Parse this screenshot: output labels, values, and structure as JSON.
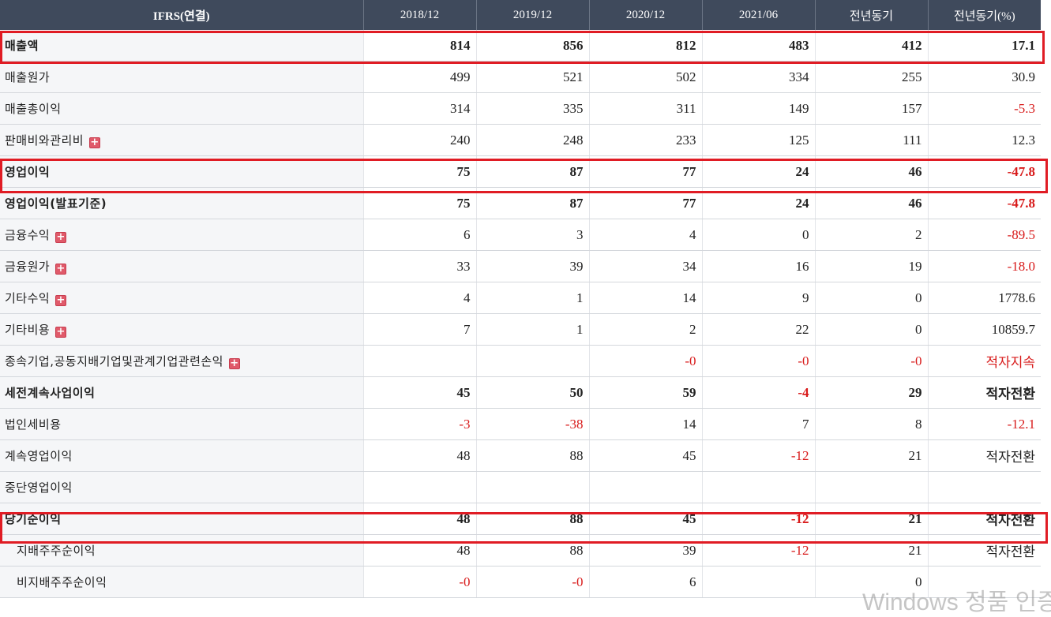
{
  "header": {
    "label": "IFRS(연결)",
    "columns": [
      "2018/12",
      "2019/12",
      "2020/12",
      "2021/06",
      "전년동기",
      "전년동기(%)"
    ]
  },
  "rows": [
    {
      "label": "매출액",
      "values": [
        "814",
        "856",
        "812",
        "483",
        "412",
        "17.1"
      ]
    },
    {
      "label": "매출원가",
      "values": [
        "499",
        "521",
        "502",
        "334",
        "255",
        "30.9"
      ]
    },
    {
      "label": "매출총이익",
      "values": [
        "314",
        "335",
        "311",
        "149",
        "157",
        "-5.3"
      ]
    },
    {
      "label": "판매비와관리비",
      "values": [
        "240",
        "248",
        "233",
        "125",
        "111",
        "12.3"
      ]
    },
    {
      "label": "영업이익",
      "values": [
        "75",
        "87",
        "77",
        "24",
        "46",
        "-47.8"
      ]
    },
    {
      "label": "영업이익(발표기준)",
      "values": [
        "75",
        "87",
        "77",
        "24",
        "46",
        "-47.8"
      ]
    },
    {
      "label": "금융수익",
      "values": [
        "6",
        "3",
        "4",
        "0",
        "2",
        "-89.5"
      ]
    },
    {
      "label": "금융원가",
      "values": [
        "33",
        "39",
        "34",
        "16",
        "19",
        "-18.0"
      ]
    },
    {
      "label": "기타수익",
      "values": [
        "4",
        "1",
        "14",
        "9",
        "0",
        "1778.6"
      ]
    },
    {
      "label": "기타비용",
      "values": [
        "7",
        "1",
        "2",
        "22",
        "0",
        "10859.7"
      ]
    },
    {
      "label": "종속기업,공동지배기업및관계기업관련손익",
      "values": [
        "",
        "",
        "-0",
        "-0",
        "-0",
        "적자지속"
      ]
    },
    {
      "label": "세전계속사업이익",
      "values": [
        "45",
        "50",
        "59",
        "-4",
        "29",
        "적자전환"
      ]
    },
    {
      "label": "법인세비용",
      "values": [
        "-3",
        "-38",
        "14",
        "7",
        "8",
        "-12.1"
      ]
    },
    {
      "label": "계속영업이익",
      "values": [
        "48",
        "88",
        "45",
        "-12",
        "21",
        "적자전환"
      ]
    },
    {
      "label": "중단영업이익",
      "values": [
        "",
        "",
        "",
        "",
        "",
        ""
      ]
    },
    {
      "label": "당기순이익",
      "values": [
        "48",
        "88",
        "45",
        "-12",
        "21",
        "적자전환"
      ]
    },
    {
      "label": "지배주주순이익",
      "values": [
        "48",
        "88",
        "39",
        "-12",
        "21",
        "적자전환"
      ]
    },
    {
      "label": "비지배주주순이익",
      "values": [
        "-0",
        "-0",
        "6",
        "",
        "0",
        ""
      ]
    }
  ],
  "expand_icon": "plus-box-icon",
  "colors": {
    "header_bg": "#3f4a5c",
    "negative": "#d81b1b",
    "highlight": "#e01c24"
  },
  "watermark": "Windows 정품 인증"
}
